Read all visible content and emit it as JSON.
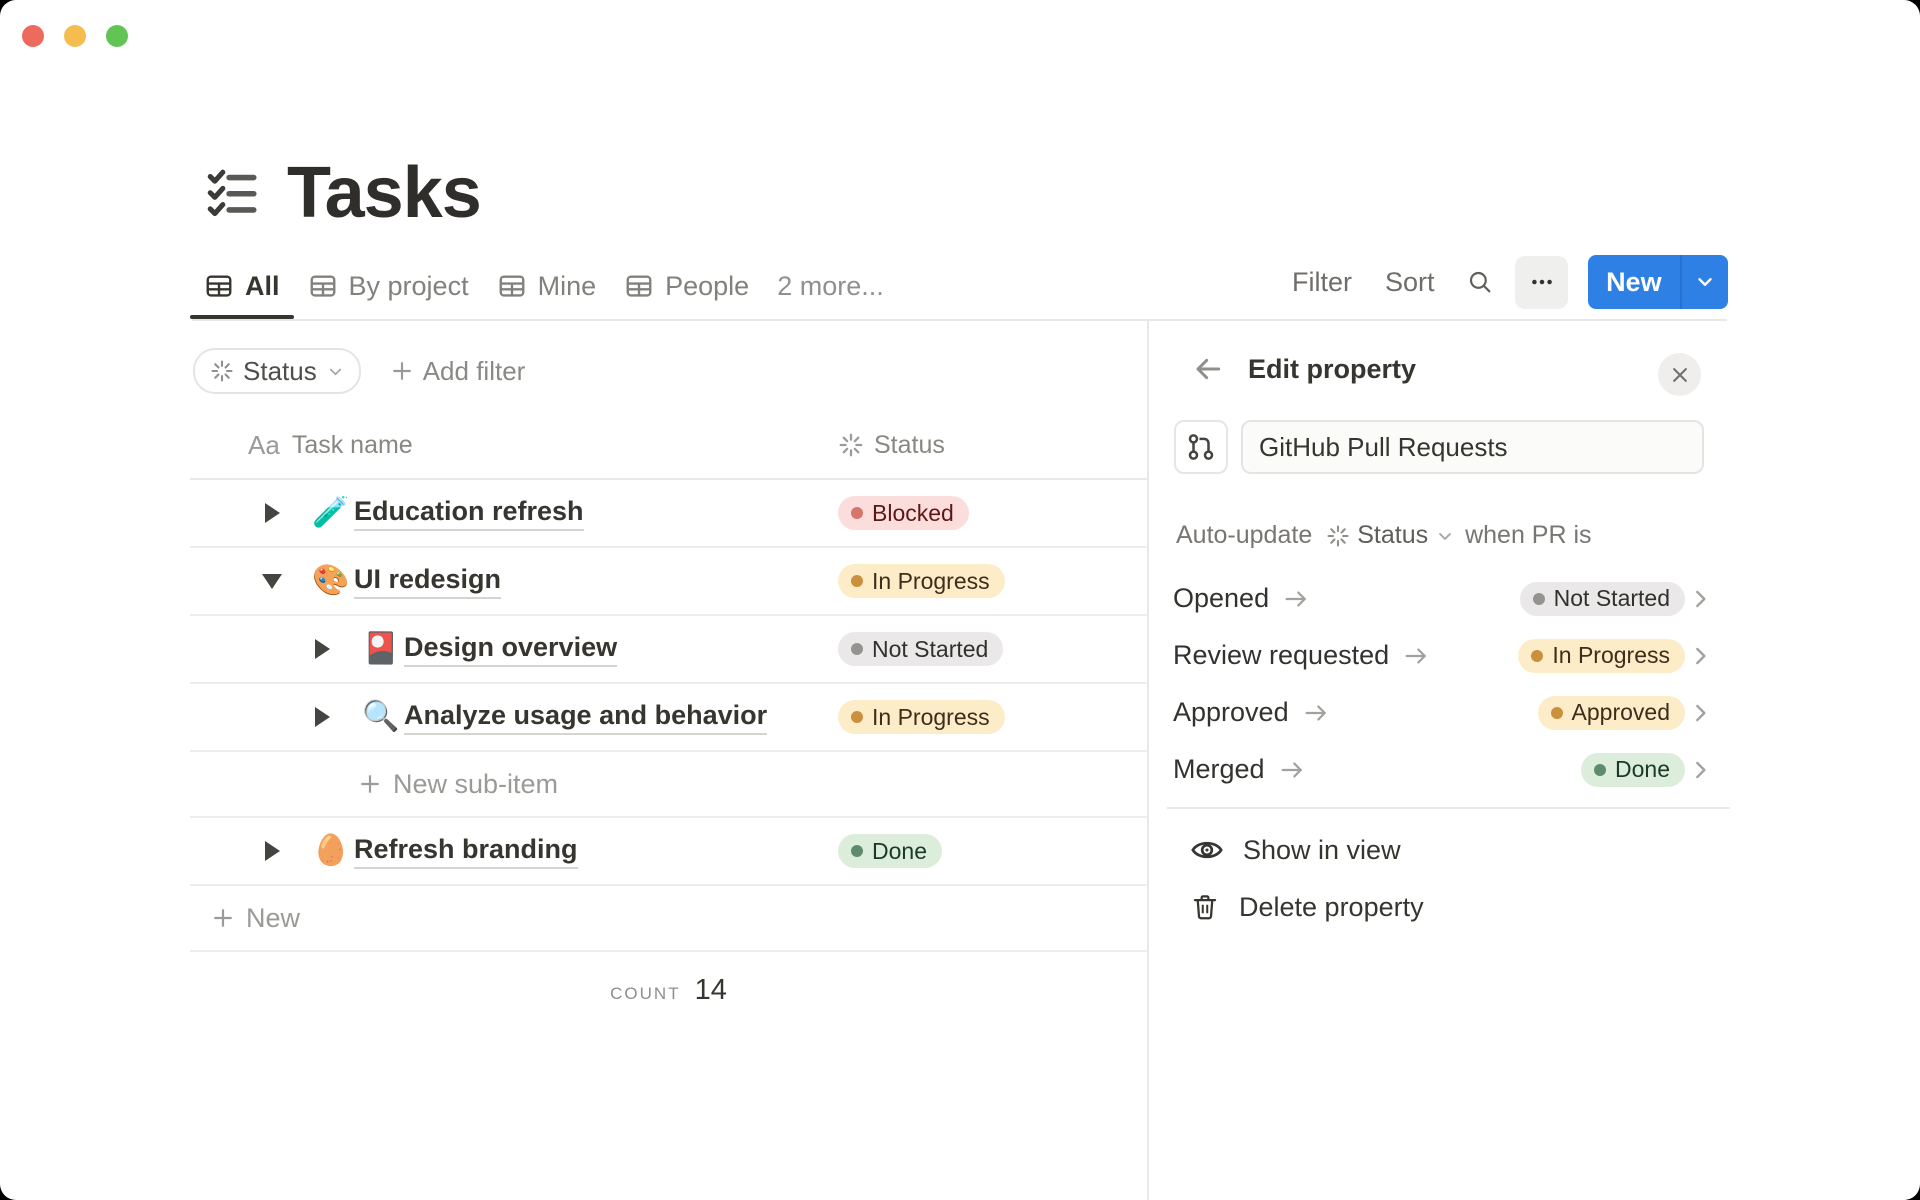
{
  "window": {
    "traffic_lights": [
      "close",
      "minimize",
      "zoom"
    ]
  },
  "page": {
    "title": "Tasks"
  },
  "tabs": {
    "items": [
      {
        "label": "All",
        "active": true
      },
      {
        "label": "By project",
        "active": false
      },
      {
        "label": "Mine",
        "active": false
      },
      {
        "label": "People",
        "active": false
      }
    ],
    "more_label": "2 more..."
  },
  "toolbar": {
    "filter_label": "Filter",
    "sort_label": "Sort",
    "new_label": "New"
  },
  "filter_bar": {
    "status_filter_label": "Status",
    "add_filter_label": "Add filter"
  },
  "table": {
    "columns": {
      "name": "Task name",
      "name_icon": "Aa",
      "status": "Status"
    },
    "rows": [
      {
        "title": "Education refresh",
        "emoji": "🧪",
        "status": "Blocked",
        "status_color": "red",
        "indent": 0,
        "expanded": false
      },
      {
        "title": "UI redesign",
        "emoji": "🎨",
        "status": "In Progress",
        "status_color": "yellow",
        "indent": 0,
        "expanded": true
      },
      {
        "title": "Design overview",
        "emoji": "🎴",
        "status": "Not Started",
        "status_color": "gray",
        "indent": 1,
        "expanded": false
      },
      {
        "title": "Analyze usage and behavior",
        "emoji": "🔍",
        "status": "In Progress",
        "status_color": "yellow",
        "indent": 1,
        "expanded": false
      },
      {
        "title": "Refresh branding",
        "emoji": "🥚",
        "status": "Done",
        "status_color": "green",
        "indent": 0,
        "expanded": false
      }
    ],
    "new_sub_item_label": "New sub-item",
    "new_row_label": "New",
    "count_label": "COUNT",
    "count_value": "14"
  },
  "panel": {
    "title": "Edit property",
    "property_name_value": "GitHub Pull Requests",
    "auto_update_prefix": "Auto-update",
    "auto_update_property": "Status",
    "auto_update_suffix": "when PR is",
    "mappings": [
      {
        "event": "Opened",
        "status": "Not Started",
        "status_color": "gray"
      },
      {
        "event": "Review requested",
        "status": "In Progress",
        "status_color": "yellow"
      },
      {
        "event": "Approved",
        "status": "Approved",
        "status_color": "yellow"
      },
      {
        "event": "Merged",
        "status": "Done",
        "status_color": "green"
      }
    ],
    "show_in_view_label": "Show in view",
    "delete_property_label": "Delete property"
  },
  "colors": {
    "accent_blue": "#2e80e5",
    "traffic_red": "#ee6a5e",
    "traffic_yellow": "#f5bd4f",
    "traffic_green": "#61c454",
    "status_red_bg": "#fbdedb",
    "status_red_dot": "#d8756a",
    "status_red_text": "#5d1715",
    "status_yellow_bg": "#fdecc8",
    "status_yellow_dot": "#c9913d",
    "status_yellow_text": "#402c1b",
    "status_gray_bg": "#eae8e8",
    "status_gray_dot": "#949390",
    "status_gray_text": "#32302c",
    "status_green_bg": "#dceddb",
    "status_green_dot": "#5d8c6d",
    "status_green_text": "#1c3829"
  }
}
